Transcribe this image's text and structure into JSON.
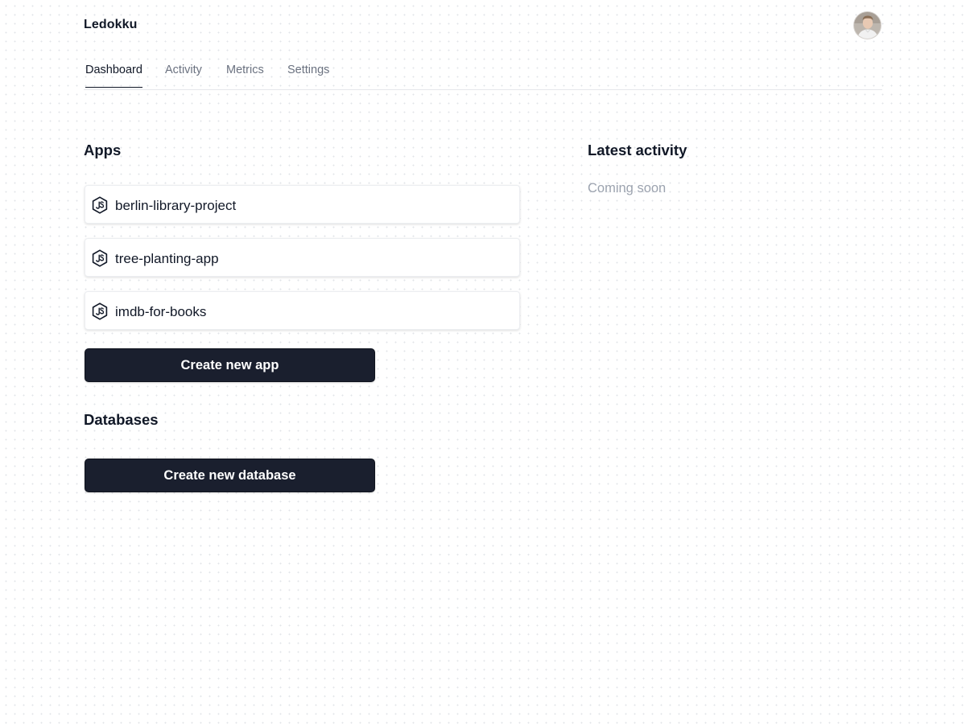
{
  "header": {
    "brand": "Ledokku",
    "avatar_alt": "User avatar"
  },
  "tabs": [
    {
      "label": "Dashboard",
      "active": true
    },
    {
      "label": "Activity",
      "active": false
    },
    {
      "label": "Metrics",
      "active": false
    },
    {
      "label": "Settings",
      "active": false
    }
  ],
  "apps": {
    "title": "Apps",
    "items": [
      {
        "name": "berlin-library-project",
        "icon": "nodejs-icon"
      },
      {
        "name": "tree-planting-app",
        "icon": "nodejs-icon"
      },
      {
        "name": "imdb-for-books",
        "icon": "nodejs-icon"
      }
    ],
    "create_button": "Create new app"
  },
  "databases": {
    "title": "Databases",
    "create_button": "Create new database"
  },
  "activity": {
    "title": "Latest activity",
    "placeholder": "Coming soon"
  },
  "colors": {
    "primary_button": "#1a1f2e",
    "muted_text": "#9ca3af",
    "tab_inactive": "#6b7280",
    "text": "#111827"
  }
}
